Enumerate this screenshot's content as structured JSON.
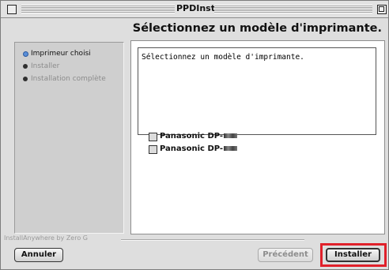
{
  "window": {
    "title": "PPDInst",
    "heading": "Sélectionnez un modèle d'imprimante."
  },
  "steps": [
    {
      "label": "Imprimeur choisi",
      "state": "current"
    },
    {
      "label": "Installer",
      "state": "pending"
    },
    {
      "label": "Installation complète",
      "state": "pending"
    }
  ],
  "content": {
    "prompt": "Sélectionnez un modèle d'imprimante.",
    "options": [
      {
        "label": "Panasonic DP-",
        "checked": false
      },
      {
        "label": "Panasonic DP-",
        "checked": false
      }
    ]
  },
  "footer": {
    "brand": "InstallAnywhere by Zero G"
  },
  "buttons": {
    "cancel": "Annuler",
    "previous": "Précédent",
    "install": "Installer"
  },
  "colors": {
    "highlight": "#e0202a",
    "current_step": "#5a8fd8"
  }
}
